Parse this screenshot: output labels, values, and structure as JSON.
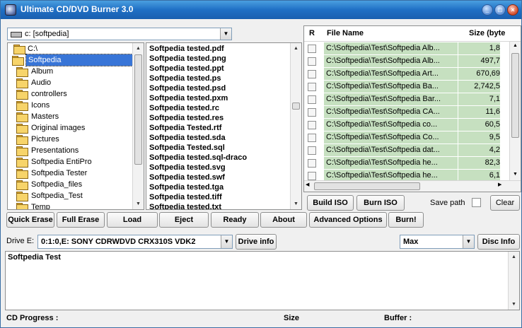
{
  "window": {
    "title": "Ultimate CD/DVD Burner 3.0",
    "controls": [
      "_",
      "□",
      "×"
    ]
  },
  "drive_combo": {
    "value": "c: [softpedia]"
  },
  "tree": {
    "root": "C:\\",
    "selected": "Softpedia",
    "items": [
      "Album",
      "Audio",
      "controllers",
      "Icons",
      "Masters",
      "Original images",
      "Pictures",
      "Presentations",
      "Softpedia EntiPro",
      "Softpedia Tester",
      "Softpedia_files",
      "Softpedia_Test",
      "Temp"
    ]
  },
  "files": [
    "Softpedia tested.pdf",
    "Softpedia tested.png",
    "Softpedia tested.ppt",
    "Softpedia tested.ps",
    "Softpedia tested.psd",
    "Softpedia tested.pxm",
    "Softpedia tested.rc",
    "Softpedia tested.res",
    "Softpedia Tested.rtf",
    "Softpedia tested.sda",
    "Softpedia Tested.sql",
    "Softpedia tested.sql-draco",
    "Softpedia tested.svg",
    "Softpedia tested.swf",
    "Softpedia tested.tga",
    "Softpedia tested.tiff",
    "Softpedia tested.txt"
  ],
  "grid": {
    "headers": {
      "r": "R",
      "name": "File Name",
      "size": "Size (byte"
    },
    "rows": [
      {
        "name": "C:\\Softpedia\\Test\\Softpedia Alb...",
        "size": "1,8"
      },
      {
        "name": "C:\\Softpedia\\Test\\Softpedia Alb...",
        "size": "497,7"
      },
      {
        "name": "C:\\Softpedia\\Test\\Softpedia Art...",
        "size": "670,69"
      },
      {
        "name": "C:\\Softpedia\\Test\\Softpedia Ba...",
        "size": "2,742,5"
      },
      {
        "name": "C:\\Softpedia\\Test\\Softpedia Bar...",
        "size": "7,1"
      },
      {
        "name": "C:\\Softpedia\\Test\\Softpedia CA...",
        "size": "11,6"
      },
      {
        "name": "C:\\Softpedia\\Test\\Softpedia co...",
        "size": "60,5"
      },
      {
        "name": "C:\\Softpedia\\Test\\Softpedia Co...",
        "size": "9,5"
      },
      {
        "name": "C:\\Softpedia\\Test\\Softpedia dat...",
        "size": "4,2"
      },
      {
        "name": "C:\\Softpedia\\Test\\Softpedia he...",
        "size": "82,3"
      },
      {
        "name": "C:\\Softpedia\\Test\\Softpedia he...",
        "size": "6,1"
      }
    ],
    "row_color": "#c6e0c0"
  },
  "right_buttons": {
    "build_iso": "Build ISO",
    "burn_iso": "Burn ISO",
    "save_path": "Save path",
    "clear": "Clear"
  },
  "toolbar": {
    "quick_erase": "Quick Erase",
    "full_erase": "Full Erase",
    "load": "Load",
    "eject": "Eject",
    "ready": "Ready",
    "about": "About",
    "advanced": "Advanced Options",
    "burn": "Burn!"
  },
  "drive_row": {
    "label": "Drive E:",
    "drive_value": "0:1:0,E: SONY    CDRWDVD CRX310S VDK2",
    "drive_info": "Drive info",
    "speed_value": "Max",
    "disc_info": "Disc Info"
  },
  "log": {
    "text": "Softpedia Test"
  },
  "status": {
    "cd_progress": "CD Progress :",
    "size": "Size",
    "buffer": "Buffer :"
  }
}
